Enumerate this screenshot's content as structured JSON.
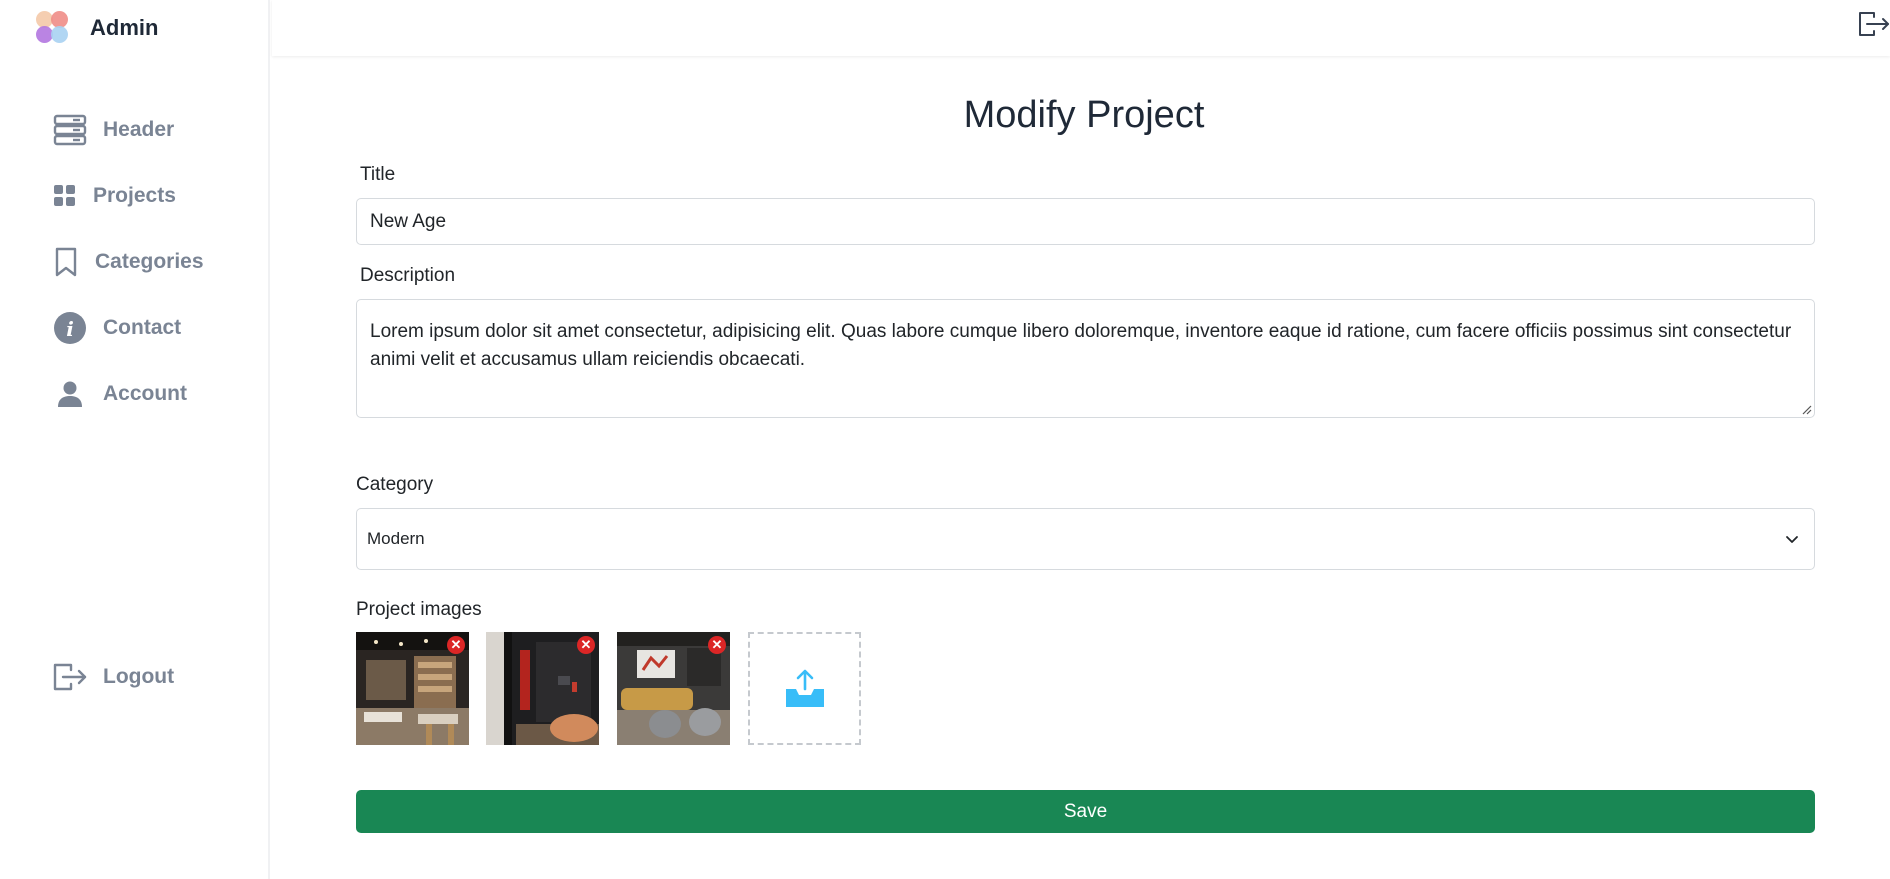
{
  "brand": {
    "title": "Admin",
    "logo_icon": "petal-logo-icon"
  },
  "sidebar": {
    "items": [
      {
        "label": "Header",
        "icon": "server-stack-icon"
      },
      {
        "label": "Projects",
        "icon": "grid-icon"
      },
      {
        "label": "Categories",
        "icon": "bookmark-icon"
      },
      {
        "label": "Contact",
        "icon": "info-icon"
      },
      {
        "label": "Account",
        "icon": "user-icon"
      }
    ],
    "logout": {
      "label": "Logout",
      "icon": "logout-icon"
    }
  },
  "topbar": {
    "exit_icon": "logout-icon"
  },
  "form": {
    "page_title": "Modify Project",
    "title_label": "Title",
    "title_value": "New Age",
    "description_label": "Description",
    "description_value": "Lorem ipsum dolor sit amet consectetur, adipisicing elit. Quas labore cumque libero doloremque, inventore eaque id ratione, cum facere officiis possimus sint consectetur animi velit et accusamus ullam reiciendis obcaecati.",
    "category_label": "Category",
    "category_value": "Modern",
    "images_label": "Project images",
    "images": [
      {
        "alt": "retail store interior"
      },
      {
        "alt": "dark living room with orange chair"
      },
      {
        "alt": "lounge with yellow sofa"
      }
    ],
    "remove_symbol": "✕",
    "save_label": "Save"
  },
  "colors": {
    "accent": "#198754",
    "sidebar_text": "#7a8494",
    "danger": "#dc2626",
    "upload_icon": "#38bdf8"
  }
}
